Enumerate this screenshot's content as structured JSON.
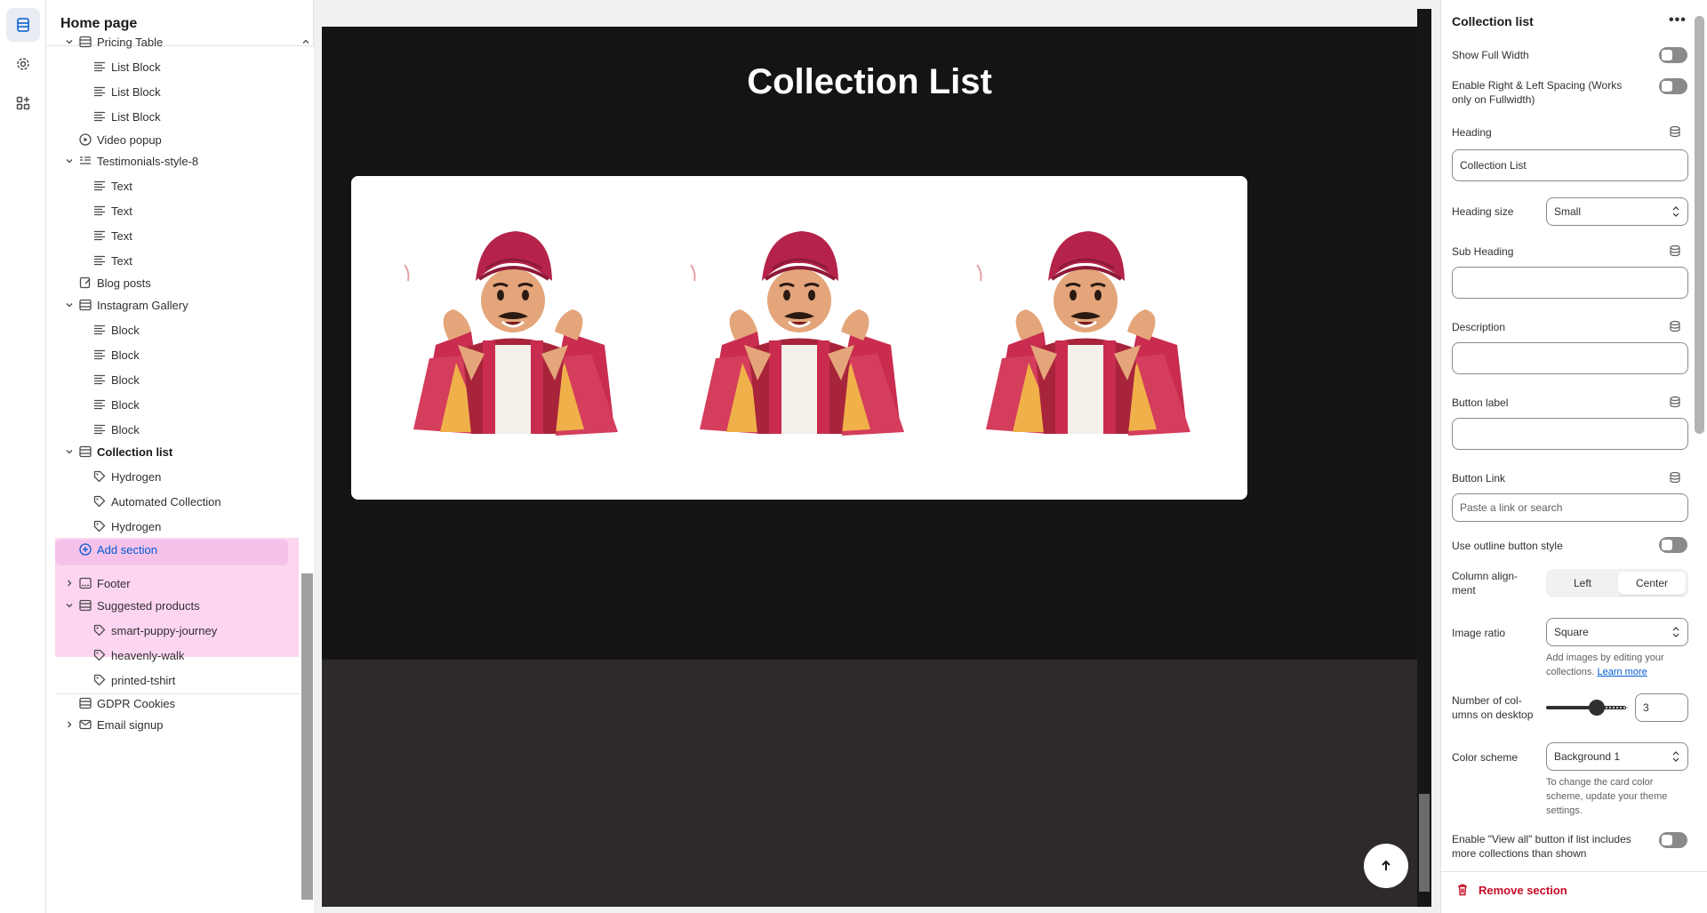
{
  "sidebar": {
    "title": "Home page",
    "items": [
      {
        "label": "Pricing Table",
        "icon": "section-icon",
        "level": 1,
        "expanded": true
      },
      {
        "label": "List Block",
        "icon": "text-block-icon",
        "level": 2
      },
      {
        "label": "List Block",
        "icon": "text-block-icon",
        "level": 2
      },
      {
        "label": "List Block",
        "icon": "text-block-icon",
        "level": 2
      },
      {
        "label": "Video popup",
        "icon": "play-icon",
        "level": 1
      },
      {
        "label": "Testimonials-style-8",
        "icon": "testimonial-icon",
        "level": 1,
        "expanded": true
      },
      {
        "label": "Text",
        "icon": "text-block-icon",
        "level": 2
      },
      {
        "label": "Text",
        "icon": "text-block-icon",
        "level": 2
      },
      {
        "label": "Text",
        "icon": "text-block-icon",
        "level": 2
      },
      {
        "label": "Text",
        "icon": "text-block-icon",
        "level": 2
      },
      {
        "label": "Blog posts",
        "icon": "blog-icon",
        "level": 1
      },
      {
        "label": "Instagram Gallery",
        "icon": "section-icon",
        "level": 1,
        "expanded": true
      },
      {
        "label": "Block",
        "icon": "text-block-icon",
        "level": 2
      },
      {
        "label": "Block",
        "icon": "text-block-icon",
        "level": 2
      },
      {
        "label": "Block",
        "icon": "text-block-icon",
        "level": 2
      },
      {
        "label": "Block",
        "icon": "text-block-icon",
        "level": 2
      },
      {
        "label": "Block",
        "icon": "text-block-icon",
        "level": 2
      },
      {
        "label": "Collection list",
        "icon": "section-icon",
        "level": 1,
        "expanded": true,
        "selected": true
      },
      {
        "label": "Hydrogen",
        "icon": "tag-icon",
        "level": 2
      },
      {
        "label": "Automated Collection",
        "icon": "tag-icon",
        "level": 2
      },
      {
        "label": "Hydrogen",
        "icon": "tag-icon",
        "level": 2
      },
      {
        "label": "Add section",
        "icon": "plus-circle-icon",
        "level": 1
      },
      {
        "label": "Footer",
        "icon": "footer-icon",
        "level": 1,
        "expanded": false
      },
      {
        "label": "Suggested products",
        "icon": "section-icon",
        "level": 1,
        "expanded": true
      },
      {
        "label": "smart-puppy-journey",
        "icon": "tag-icon",
        "level": 2
      },
      {
        "label": "heavenly-walk",
        "icon": "tag-icon",
        "level": 2
      },
      {
        "label": "printed-tshirt",
        "icon": "tag-icon",
        "level": 2
      },
      {
        "label": "GDPR Cookies",
        "icon": "section-icon",
        "level": 1
      },
      {
        "label": "Email signup",
        "icon": "mail-icon",
        "level": 1,
        "expanded": false
      }
    ]
  },
  "preview": {
    "heading": "Collection List",
    "card_count": 3,
    "background": "#151414",
    "lower_background": "#2f2a2a"
  },
  "settings": {
    "title": "Collection list",
    "show_full_width": "Show Full Width",
    "enable_spacing": "Enable Right & Left Spacing (Works only on Fullwidth)",
    "heading_label": "Heading",
    "heading_value": "Collection List",
    "heading_size_label": "Heading size",
    "heading_size_value": "Small",
    "sub_heading_label": "Sub Heading",
    "description_label": "Description",
    "button_label_label": "Button label",
    "button_link_label": "Button Link",
    "button_link_placeholder": "Paste a link or search",
    "outline_label": "Use outline button style",
    "column_align_label": "Column align-\nment",
    "align_left": "Left",
    "align_center": "Center",
    "align_selected": "Center",
    "image_ratio_label": "Image ratio",
    "image_ratio_value": "Square",
    "image_help_text": "Add images by editing your collections.",
    "learn_more": "Learn more",
    "columns_label": "Number of col-\numns on desktop",
    "columns_value": "3",
    "color_scheme_label": "Color scheme",
    "color_scheme_value": "Background 1",
    "color_help": "To change the card color scheme, update your theme settings.",
    "view_all_label": "Enable \"View all\" button if list includes more collections than shown",
    "remove_section": "Remove section",
    "accent_danger": "#c70a24",
    "accent_link": "#005bd3"
  }
}
